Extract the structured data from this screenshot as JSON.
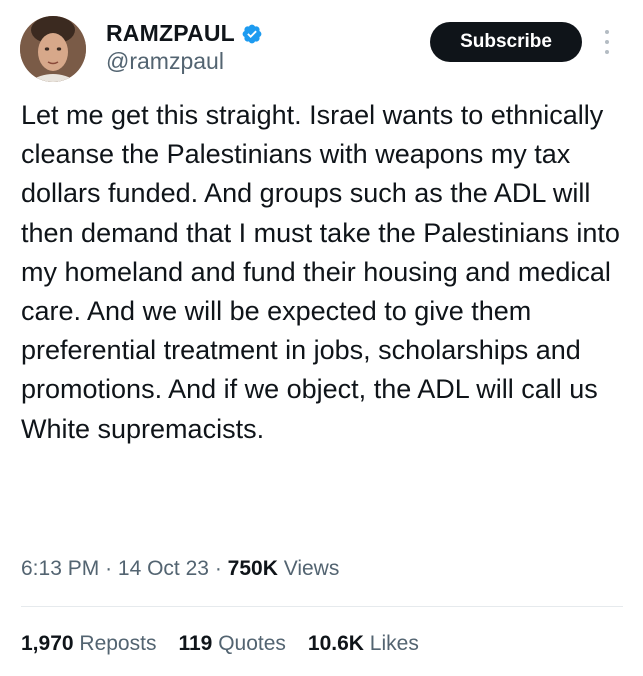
{
  "author": {
    "display_name": "RAMZPAUL",
    "handle": "@ramzpaul",
    "verified_icon": "verified-badge-icon",
    "avatar_icon": "profile-avatar"
  },
  "header": {
    "subscribe_label": "Subscribe",
    "more_icon": "more-vertical-icon"
  },
  "tweet": {
    "text": "Let me get this straight. Israel wants to ethnically cleanse the Palestinians with weapons my tax dollars funded. And groups such as the ADL will then demand that I must take the Palestinians into my homeland and fund their housing and medical care. And we will be expected to give them preferential treatment in jobs, scholarships and promotions. And if we object, the ADL will call us White supremacists."
  },
  "meta": {
    "time": "6:13 PM",
    "separator": "·",
    "date": "14 Oct 23",
    "views_count": "750K",
    "views_label": "Views"
  },
  "stats": {
    "reposts_count": "1,970",
    "reposts_label": "Reposts",
    "quotes_count": "119",
    "quotes_label": "Quotes",
    "likes_count": "10.6K",
    "likes_label": "Likes"
  },
  "colors": {
    "text_primary": "#0f1419",
    "text_secondary": "#536471",
    "verified_blue": "#1d9bf0",
    "button_bg": "#0f1419"
  }
}
